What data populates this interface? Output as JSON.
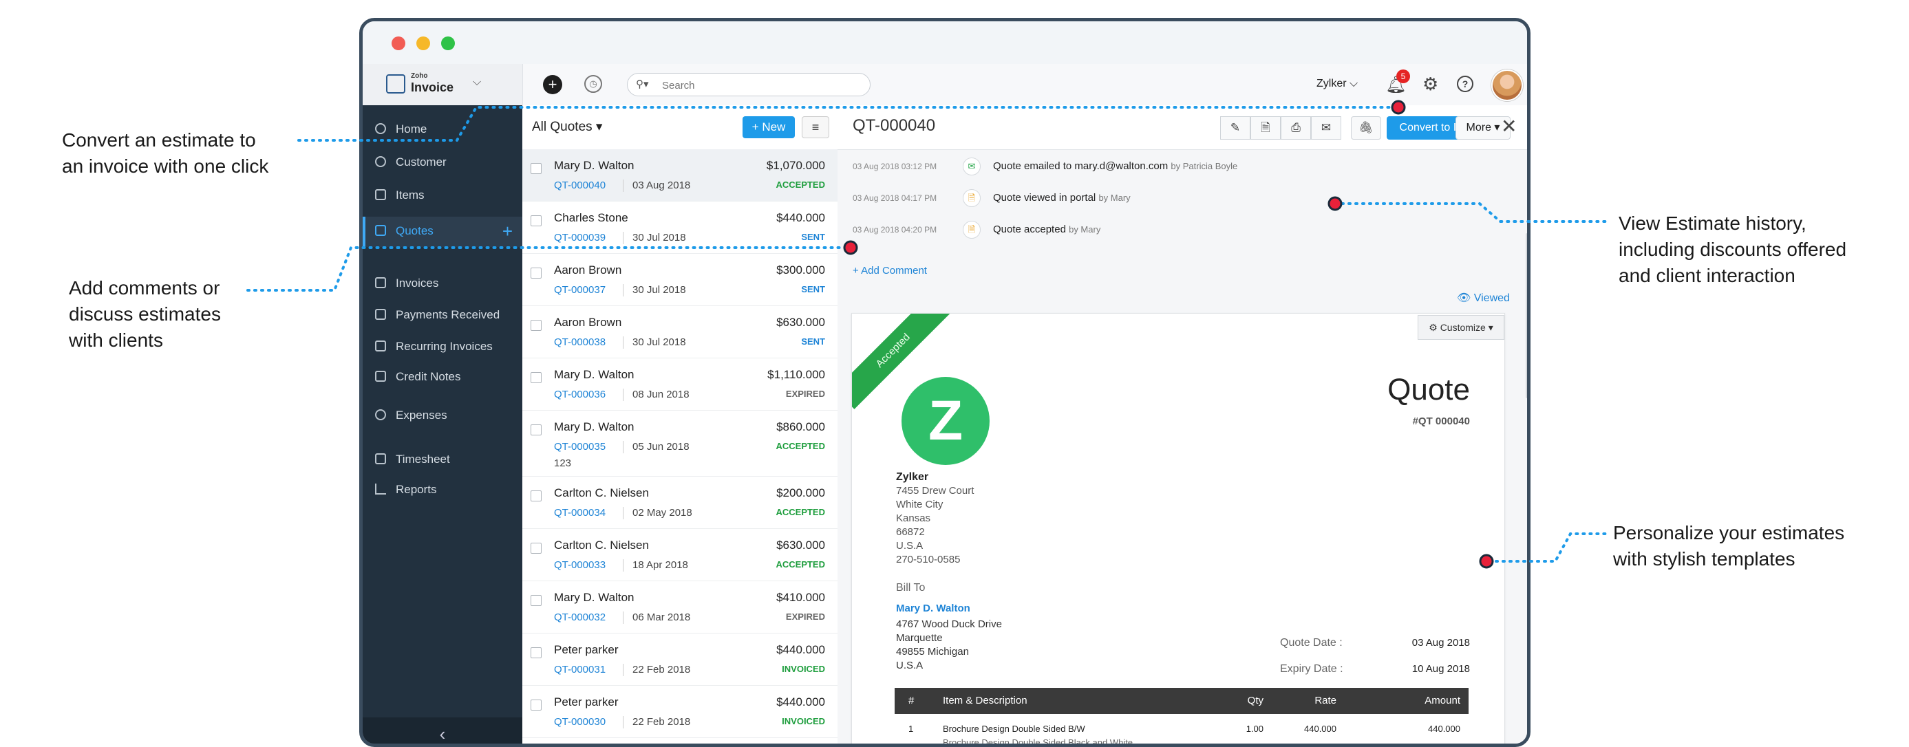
{
  "callouts": {
    "convert": [
      "Convert an estimate to",
      "an invoice with one click"
    ],
    "comments": [
      "Add comments or",
      "discuss estimates",
      "with clients"
    ],
    "history": [
      "View Estimate history,",
      "including discounts offered",
      "and client interaction"
    ],
    "personalize": [
      "Personalize your estimates",
      "with stylish templates"
    ]
  },
  "app": {
    "brand_small": "Zoho",
    "brand_name": "Invoice",
    "search_placeholder": "Search",
    "org_name": "Zylker",
    "notification_count": "5"
  },
  "sidebar": {
    "items": [
      {
        "label": "Home",
        "icon": "home-icon"
      },
      {
        "label": "Customer",
        "icon": "user-icon"
      },
      {
        "label": "Items",
        "icon": "basket-icon"
      },
      {
        "label": "Quotes",
        "icon": "quote-icon",
        "active": true
      },
      {
        "label": "Invoices",
        "icon": "invoice-icon"
      },
      {
        "label": "Payments Received",
        "icon": "payment-icon"
      },
      {
        "label": "Recurring Invoices",
        "icon": "recurring-icon"
      },
      {
        "label": "Credit Notes",
        "icon": "credit-note-icon"
      },
      {
        "label": "Expenses",
        "icon": "expense-icon"
      },
      {
        "label": "Timesheet",
        "icon": "calendar-icon"
      },
      {
        "label": "Reports",
        "icon": "chart-icon"
      }
    ]
  },
  "list": {
    "title": "All Quotes",
    "new_label": "New",
    "rows": [
      {
        "name": "Mary D. Walton",
        "amount": "$1,070.000",
        "number": "QT-000040",
        "date": "03 Aug 2018",
        "status": "ACCEPTED",
        "extra": ""
      },
      {
        "name": "Charles Stone",
        "amount": "$440.000",
        "number": "QT-000039",
        "date": "30 Jul 2018",
        "status": "SENT",
        "extra": ""
      },
      {
        "name": "Aaron Brown",
        "amount": "$300.000",
        "number": "QT-000037",
        "date": "30 Jul 2018",
        "status": "SENT",
        "extra": ""
      },
      {
        "name": "Aaron Brown",
        "amount": "$630.000",
        "number": "QT-000038",
        "date": "30 Jul 2018",
        "status": "SENT",
        "extra": ""
      },
      {
        "name": "Mary D. Walton",
        "amount": "$1,110.000",
        "number": "QT-000036",
        "date": "08 Jun 2018",
        "status": "EXPIRED",
        "extra": ""
      },
      {
        "name": "Mary D. Walton",
        "amount": "$860.000",
        "number": "QT-000035",
        "date": "05 Jun 2018",
        "status": "ACCEPTED",
        "extra": "123"
      },
      {
        "name": "Carlton C. Nielsen",
        "amount": "$200.000",
        "number": "QT-000034",
        "date": "02 May 2018",
        "status": "ACCEPTED",
        "extra": ""
      },
      {
        "name": "Carlton C. Nielsen",
        "amount": "$630.000",
        "number": "QT-000033",
        "date": "18 Apr 2018",
        "status": "ACCEPTED",
        "extra": ""
      },
      {
        "name": "Mary D. Walton",
        "amount": "$410.000",
        "number": "QT-000032",
        "date": "06 Mar 2018",
        "status": "EXPIRED",
        "extra": ""
      },
      {
        "name": "Peter parker",
        "amount": "$440.000",
        "number": "QT-000031",
        "date": "22 Feb 2018",
        "status": "INVOICED",
        "extra": ""
      },
      {
        "name": "Peter parker",
        "amount": "$440.000",
        "number": "QT-000030",
        "date": "22 Feb 2018",
        "status": "INVOICED",
        "extra": ""
      }
    ]
  },
  "status_colors": {
    "ACCEPTED": "#1f9e3e",
    "SENT": "#1e84d6",
    "EXPIRED": "#666666",
    "INVOICED": "#1f9e3e"
  },
  "detail": {
    "title": "QT-000040",
    "convert_label": "Convert to Invoice",
    "more_label": "More",
    "history": [
      {
        "time": "03 Aug 2018 03:12 PM",
        "text": "Quote emailed to mary.d@walton.com",
        "by": "by Patricia Boyle",
        "icon": "mail-icon"
      },
      {
        "time": "03 Aug 2018 04:17 PM",
        "text": "Quote viewed in portal",
        "by": "by Mary",
        "icon": "document-icon"
      },
      {
        "time": "03 Aug 2018 04:20 PM",
        "text": "Quote accepted",
        "by": "by Mary",
        "icon": "document-icon"
      }
    ],
    "add_comment": "+ Add Comment",
    "viewed": "Viewed"
  },
  "document": {
    "ribbon": "Accepted",
    "customize": "Customize",
    "logo_letter": "Z",
    "title": "Quote",
    "number": "#QT 000040",
    "org_name": "Zylker",
    "org_address": [
      "7455 Drew Court",
      "White City",
      "Kansas",
      "66872",
      "U.S.A",
      "270-510-0585"
    ],
    "bill_to_label": "Bill To",
    "bill_to_name": "Mary D. Walton",
    "bill_to_address": [
      "4767 Wood Duck Drive",
      "Marquette",
      "49855 Michigan",
      "U.S.A"
    ],
    "quote_date_label": "Quote Date :",
    "quote_date": "03 Aug 2018",
    "expiry_date_label": "Expiry Date :",
    "expiry_date": "10 Aug 2018",
    "table_headers": {
      "num": "#",
      "desc": "Item & Description",
      "qty": "Qty",
      "rate": "Rate",
      "amount": "Amount"
    },
    "items": [
      {
        "num": "1",
        "name": "Brochure Design Double Sided B/W",
        "desc": "Brochure Design Double Sided Black and White",
        "qty": "1.00",
        "rate": "440.000",
        "amount": "440.000"
      }
    ]
  }
}
